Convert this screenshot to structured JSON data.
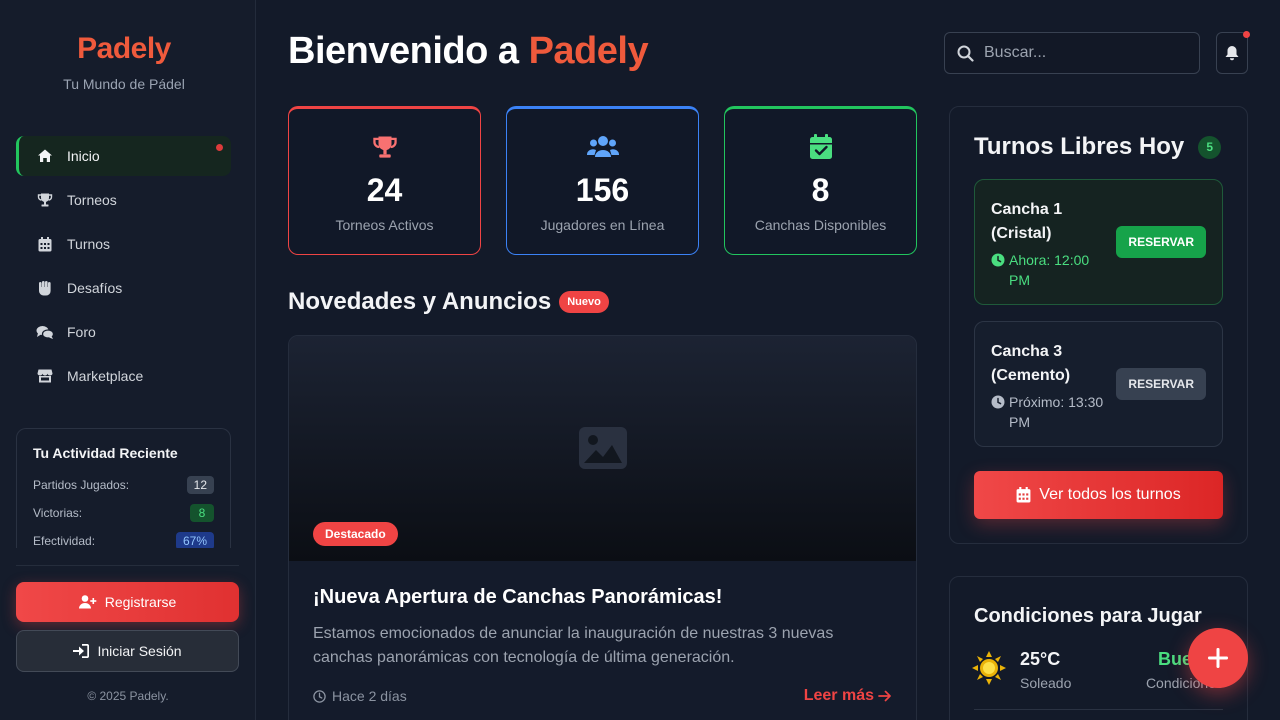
{
  "brand": {
    "name": "Padely",
    "tagline": "Tu Mundo de Pádel"
  },
  "nav": {
    "items": [
      {
        "label": "Inicio",
        "icon": "home-icon",
        "active": true
      },
      {
        "label": "Torneos",
        "icon": "trophy-icon"
      },
      {
        "label": "Turnos",
        "icon": "calendar-icon"
      },
      {
        "label": "Desafíos",
        "icon": "fist-icon"
      },
      {
        "label": "Foro",
        "icon": "chat-icon"
      },
      {
        "label": "Marketplace",
        "icon": "store-icon"
      }
    ]
  },
  "activity": {
    "title": "Tu Actividad Reciente",
    "rows": [
      {
        "label": "Partidos Jugados:",
        "value": "12"
      },
      {
        "label": "Victorias:",
        "value": "8"
      },
      {
        "label": "Efectividad:",
        "value": "67%"
      }
    ]
  },
  "auth": {
    "register": "Registrarse",
    "login": "Iniciar Sesión"
  },
  "footer": {
    "copyright": "© 2025 Padely."
  },
  "header": {
    "title_prefix": "Bienvenido a ",
    "title_accent": "Padely"
  },
  "search": {
    "placeholder": "Buscar..."
  },
  "stats": [
    {
      "value": "24",
      "label": "Torneos Activos",
      "color": "#ef4444"
    },
    {
      "value": "156",
      "label": "Jugadores en Línea",
      "color": "#3b82f6"
    },
    {
      "value": "8",
      "label": "Canchas Disponibles",
      "color": "#22c55e"
    }
  ],
  "news": {
    "heading": "Novedades y Anuncios",
    "badge": "Nuevo",
    "card": {
      "badge": "Destacado",
      "title": "¡Nueva Apertura de Canchas Panorámicas!",
      "description": "Estamos emocionados de anunciar la inauguración de nuestras 3 nuevas canchas panorámicas con tecnología de última generación.",
      "time": "Hace 2 días",
      "more": "Leer más"
    }
  },
  "slots": {
    "title": "Turnos Libres Hoy",
    "count": "5",
    "items": [
      {
        "name": "Cancha 1 (Cristal)",
        "time": "Ahora: 12:00 PM",
        "action": "RESERVAR"
      },
      {
        "name": "Cancha 3 (Cemento)",
        "time": "Próximo: 13:30 PM",
        "action": "RESERVAR"
      }
    ],
    "see_all": "Ver todos los turnos"
  },
  "weather": {
    "title": "Condiciones para Jugar",
    "temp": "25°C",
    "condition": "Soleado",
    "rating": "Buenas",
    "rating_label": "Condiciones"
  },
  "colors": {
    "accent": "#ef5a3c",
    "danger": "#ef4444",
    "success": "#22c55e",
    "info": "#3b82f6"
  }
}
